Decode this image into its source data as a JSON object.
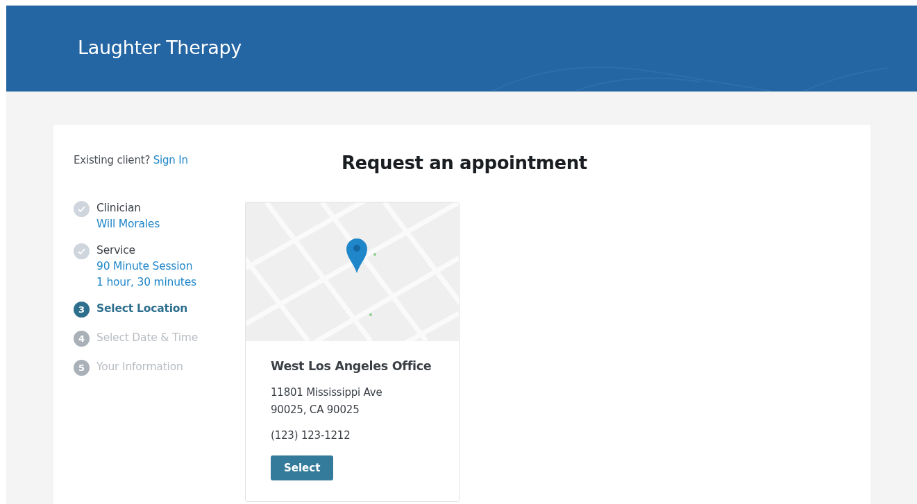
{
  "header": {
    "title": "Laughter Therapy"
  },
  "sign_in": {
    "prompt": "Existing client?",
    "link": "Sign In"
  },
  "heading": "Request an appointment",
  "steps": [
    {
      "kind": "done",
      "label": "Clinician",
      "details": [
        "Will Morales"
      ]
    },
    {
      "kind": "done",
      "label": "Service",
      "details": [
        "90 Minute Session",
        "1 hour, 30 minutes"
      ]
    },
    {
      "kind": "current",
      "number": "3",
      "label": "Select Location"
    },
    {
      "kind": "upcoming",
      "number": "4",
      "label": "Select Date & Time"
    },
    {
      "kind": "upcoming",
      "number": "5",
      "label": "Your Information"
    }
  ],
  "locations": [
    {
      "name": "West Los Angeles Office",
      "address": [
        "11801 Mississippi Ave",
        "90025, CA 90025"
      ],
      "phone": "(123) 123-1212",
      "button": "Select"
    }
  ]
}
